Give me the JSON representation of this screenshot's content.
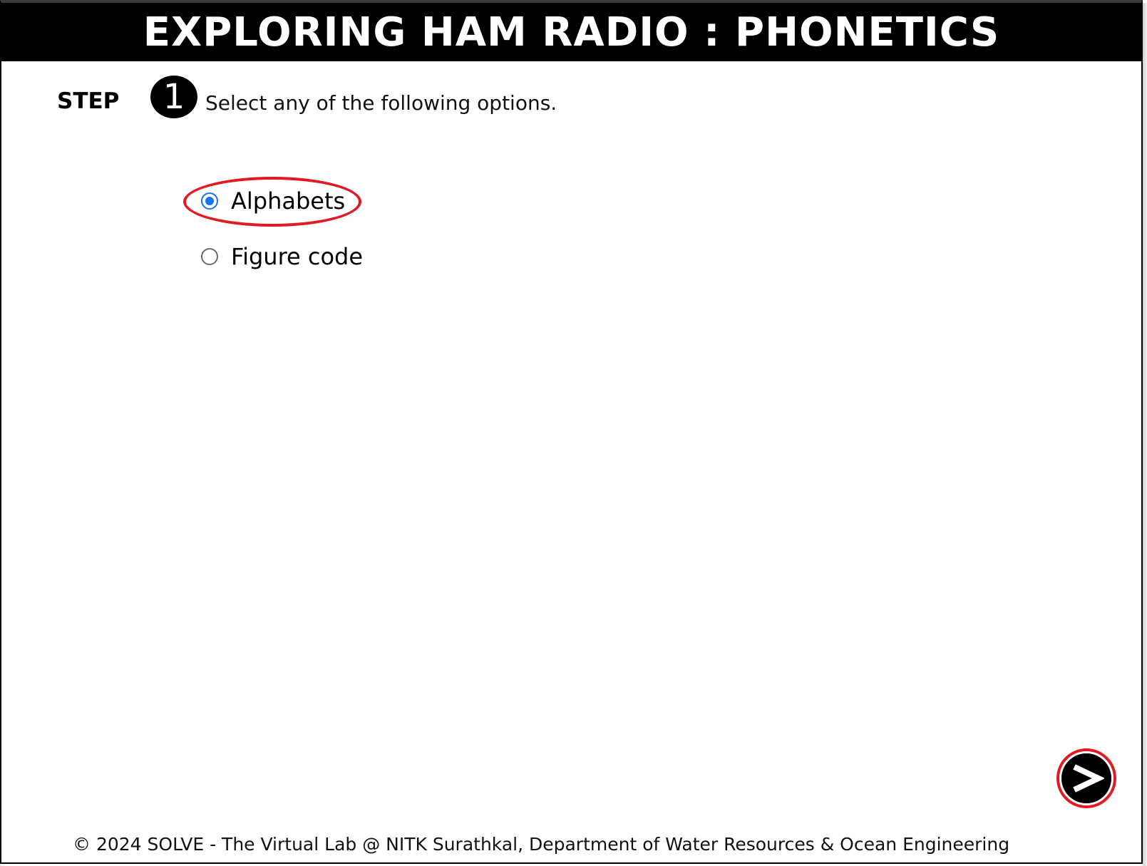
{
  "header": {
    "title": "EXPLORING HAM RADIO : PHONETICS"
  },
  "step": {
    "label": "STEP",
    "number": "1",
    "instruction": "Select any of the following options."
  },
  "options": [
    {
      "label": "Alphabets",
      "selected": true
    },
    {
      "label": "Figure code",
      "selected": false
    }
  ],
  "navigation": {
    "next_icon": "next-arrow-icon"
  },
  "footer": {
    "text": "© 2024 SOLVE - The Virtual Lab @ NITK Surathkal, Department of Water Resources & Ocean Engineering"
  },
  "colors": {
    "header_background": "#000000",
    "radio_selected": "#1a73e8",
    "highlight": "#e01b24"
  }
}
